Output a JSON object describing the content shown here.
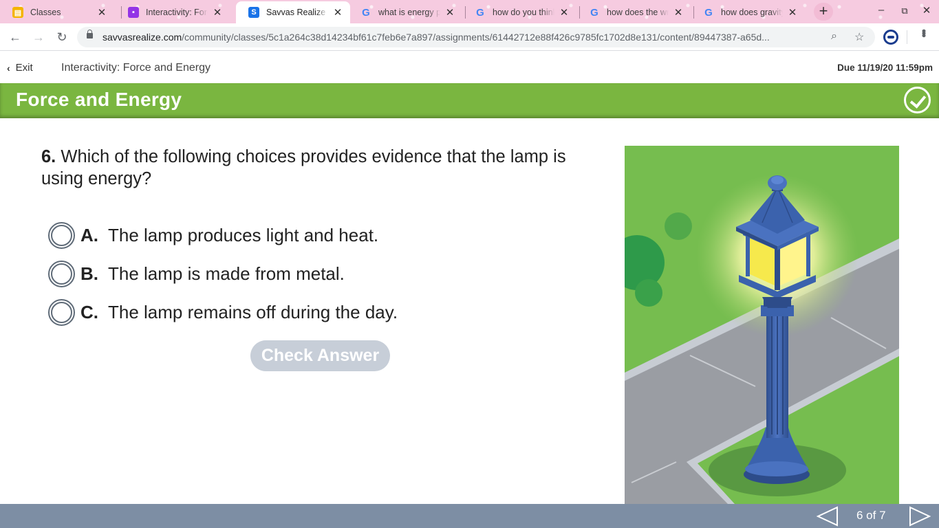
{
  "browser": {
    "tabs": [
      {
        "title": "Classes",
        "favicon": "classroom-icon",
        "color": "#f4b400"
      },
      {
        "title": "Interactivity: Force and Energy",
        "favicon": "assignment-icon",
        "color": "#9334e6"
      },
      {
        "title": "Savvas Realize",
        "favicon": "savvas-icon",
        "color": "#1a73e8",
        "active": true
      },
      {
        "title": "what is energy provided",
        "favicon": "google-icon"
      },
      {
        "title": "how do you think",
        "favicon": "google-icon"
      },
      {
        "title": "how does the wrecking",
        "favicon": "google-icon"
      },
      {
        "title": "how does gravity",
        "favicon": "google-icon"
      }
    ],
    "url_host": "savvasrealize.com",
    "url_path": "/community/classes/5c1a264c38d14234bf61c7feb6e7a897/assignments/61442712e88f426c9785fc1702d8e131/content/89447387-a65d..."
  },
  "app": {
    "exit_label": "Exit",
    "title": "Interactivity: Force and Energy",
    "due": "Due 11/19/20 11:59pm",
    "banner_title": "Force and Energy",
    "accent": "#7ab640"
  },
  "question": {
    "number": "6.",
    "text": "Which of the following choices provides evidence that the lamp is using energy?",
    "choices": [
      {
        "letter": "A.",
        "text": "The lamp produces light and heat."
      },
      {
        "letter": "B.",
        "text": "The lamp is made from metal."
      },
      {
        "letter": "C.",
        "text": "The lamp remains off during the day."
      }
    ],
    "check_label": "Check Answer"
  },
  "footer": {
    "page_indicator": "6 of 7",
    "color": "#7d8ea4"
  }
}
